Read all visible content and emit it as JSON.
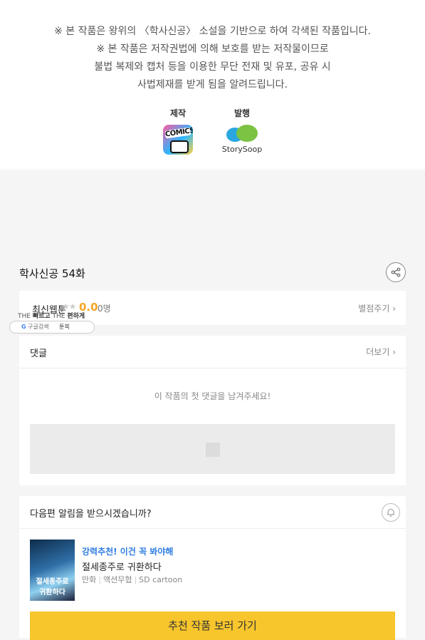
{
  "notice": {
    "lines": [
      "※ 본 작품은 왕위의 〈학사신공〉 소설을 기반으로 하여 각색된 작품입니다.",
      "※ 본 작품은 저작권법에 의해 보호를 받는 저작물이므로",
      "불법 복제와 캡처 등을 이용한 무단 전재 및 유포, 공유 시",
      "사법제재를 받게 됨을 알려드립니다."
    ]
  },
  "credits": {
    "produce_label": "제작",
    "produce_logo_text": "COMICS",
    "publish_label": "발행",
    "publish_logo_text": "StorySoop"
  },
  "episode": {
    "title": "학사신공 54화"
  },
  "rating": {
    "label": "최신웹툰",
    "stars": "★★",
    "score": "0.0",
    "count": "0명",
    "rate_link": "별점주기 ›"
  },
  "overlay_ad": {
    "line1_a": "THE",
    "line1_b": "빠르고",
    "line1_c": "THE",
    "line1_d": "편하게",
    "search_label": "구글검색",
    "bookmark_label": "툰북"
  },
  "comments": {
    "title": "댓글",
    "more_link": "더보기 ›",
    "empty_text": "이 작품의 첫 댓글을 남겨주세요!"
  },
  "next_episode": {
    "question": "다음편 알림을 받으시겠습니까?",
    "recommend_tag": "강력추천! 이건 꼭 봐야해",
    "recommend_title": "절세종주로 귀환하다",
    "thumb_text": "절세종주로 귀환하다",
    "meta": [
      "만화",
      "액션무협",
      "SD cartoon"
    ],
    "button_label": "추천 작품 보러 가기"
  }
}
